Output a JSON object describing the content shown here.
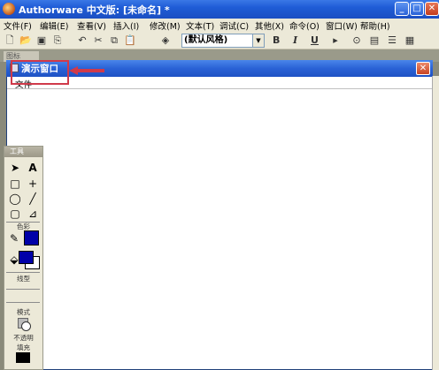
{
  "window": {
    "title": "Authorware 中文版: [未命名] *",
    "minimize": "_",
    "maximize": "□",
    "close": "✕"
  },
  "menu": [
    "文件(F)",
    "编辑(E)",
    "查看(V)",
    "插入(I)",
    "修改(M)",
    "文本(T)",
    "调试(C)",
    "其他(X)",
    "命令(O)",
    "窗口(W)",
    "帮助(H)"
  ],
  "toolbar": {
    "style_select": "(默认风格)",
    "bold": "B",
    "italic": "I",
    "underline": "U"
  },
  "background_tab": "图标",
  "presentation": {
    "title": "演示窗口",
    "menu_file": "文件",
    "close": "✕"
  },
  "tools": {
    "title": "工具",
    "color_label": "色彩",
    "line_label": "线型",
    "mode_label": "模式",
    "opaque_label": "不透明",
    "fill_label": "填充",
    "colors": {
      "line": "#0000a8",
      "foreground": "#0000a8",
      "background": "#ffffff",
      "fill": "#000000"
    }
  },
  "annotation": {
    "color": "#d03a4a"
  }
}
